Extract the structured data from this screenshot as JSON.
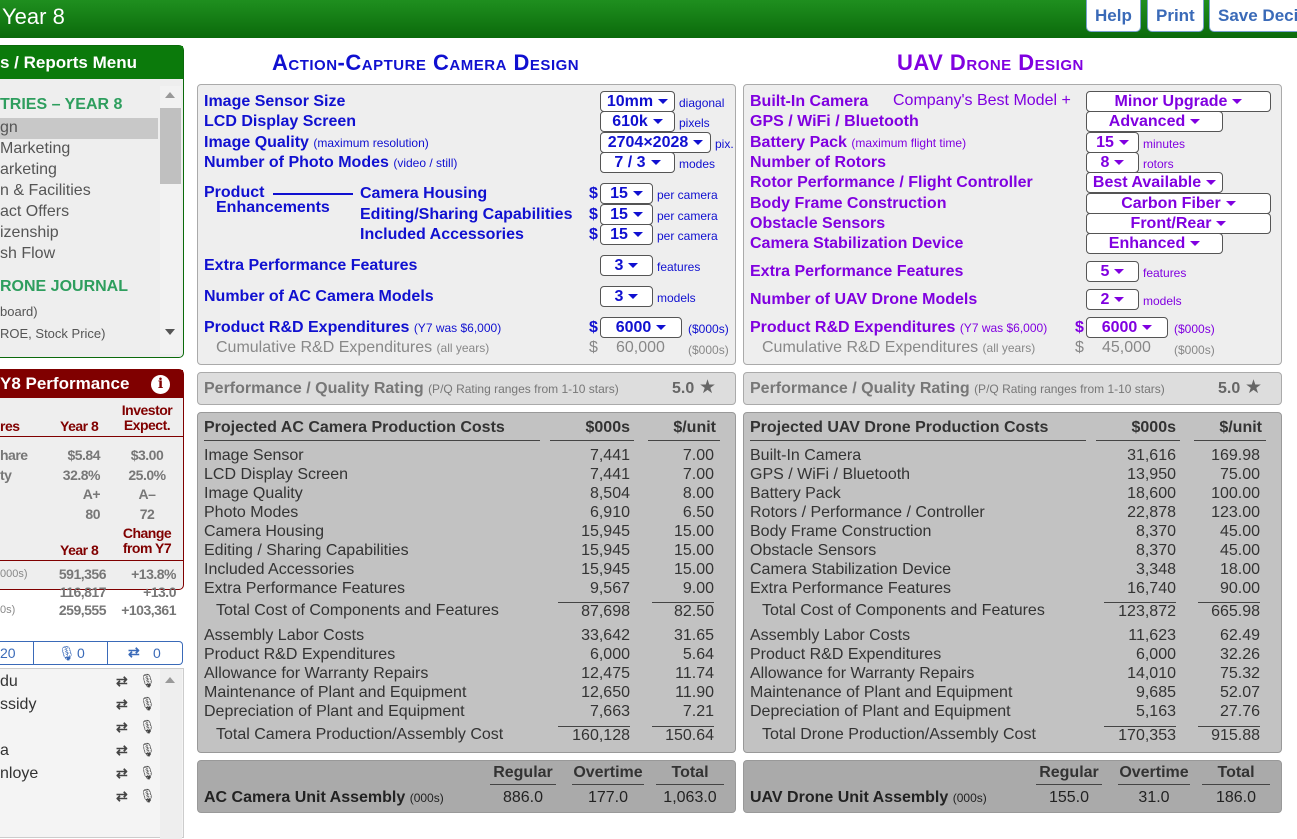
{
  "header": {
    "title": "Year 8",
    "buttons": [
      "Help",
      "Print",
      "Save Deci"
    ]
  },
  "sidebar": {
    "menu_title": "s / Reports Menu",
    "section1": "TRIES – YEAR 8",
    "items": [
      "gn",
      "Marketing",
      "arketing",
      "n & Facilities",
      "act Offers",
      "izenship",
      "sh Flow"
    ],
    "section2": "RONE JOURNAL",
    "journal_items": [
      "board)",
      "ROE, Stock Price)"
    ],
    "perf": {
      "title": "Y8 Performance",
      "col_label": "res",
      "col1": "Year 8",
      "col2": "Investor Expect.",
      "rows": [
        [
          "hare",
          "$5.84",
          "$3.00"
        ],
        [
          "ty",
          "32.8%",
          "25.0%"
        ],
        [
          "",
          "A+",
          "A–"
        ],
        [
          "",
          "80",
          "72"
        ]
      ],
      "col1b": "Year 8",
      "col2b": "Change from Y7",
      "rows2": [
        [
          "000s)",
          "591,356",
          "+13.8%"
        ],
        [
          "",
          "116,817",
          "+13.0"
        ],
        [
          "0s)",
          "259,555",
          "+103,361"
        ]
      ]
    },
    "social": {
      "count": "20",
      "mic_count": "0",
      "retweet_count": "0"
    },
    "people": [
      "du",
      "ssidy",
      "",
      "a",
      "nloye",
      ""
    ]
  },
  "camera": {
    "title": "Action-Capture Camera Design",
    "rows": [
      {
        "label": "Image Sensor Size",
        "note": "",
        "value": "10mm",
        "unit": "diagonal"
      },
      {
        "label": "LCD Display Screen",
        "note": "",
        "value": "610k",
        "unit": "pixels"
      },
      {
        "label": "Image Quality",
        "note": "(maximum resolution)",
        "value": "2704×2028",
        "unit": "pix."
      },
      {
        "label": "Number of Photo Modes",
        "note": "(video / still)",
        "value": "7 / 3",
        "unit": "modes"
      }
    ],
    "enh_label1": "Product",
    "enh_label2": "Enhancements",
    "enh": [
      {
        "label": "Camera Housing",
        "value": "15",
        "unit": "per camera"
      },
      {
        "label": "Editing/Sharing Capabilities",
        "value": "15",
        "unit": "per camera"
      },
      {
        "label": "Included Accessories",
        "value": "15",
        "unit": "per camera"
      }
    ],
    "extra": {
      "label": "Extra Performance Features",
      "value": "3",
      "unit": "features"
    },
    "models": {
      "label": "Number of AC Camera Models",
      "value": "3",
      "unit": "models"
    },
    "rd": {
      "label": "Product R&D Expenditures",
      "note": "(Y7 was $6,000)",
      "value": "6000",
      "unit": "($000s)"
    },
    "cum": {
      "label": "Cumulative R&D Expenditures",
      "note": "(all years)",
      "value": "60,000",
      "unit": "($000s)"
    },
    "rating": {
      "label": "Performance / Quality Rating",
      "note": "(P/Q Rating ranges from 1-10 stars)",
      "value": "5.0"
    },
    "costs": {
      "title": "Projected AC Camera Production Costs",
      "col1": "$000s",
      "col2": "$/unit",
      "rows": [
        [
          "Image Sensor",
          "7,441",
          "7.00"
        ],
        [
          "LCD Display Screen",
          "7,441",
          "7.00"
        ],
        [
          "Image Quality",
          "8,504",
          "8.00"
        ],
        [
          "Photo Modes",
          "6,910",
          "6.50"
        ],
        [
          "Camera Housing",
          "15,945",
          "15.00"
        ],
        [
          "Editing / Sharing Capabilities",
          "15,945",
          "15.00"
        ],
        [
          "Included Accessories",
          "15,945",
          "15.00"
        ],
        [
          "Extra Performance Features",
          "9,567",
          "9.00"
        ]
      ],
      "subtotal": [
        "Total Cost of Components and Features",
        "87,698",
        "82.50"
      ],
      "rows2": [
        [
          "Assembly Labor Costs",
          "33,642",
          "31.65"
        ],
        [
          "Product R&D Expenditures",
          "6,000",
          "5.64"
        ],
        [
          "Allowance for Warranty Repairs",
          "12,475",
          "11.74"
        ],
        [
          "Maintenance of Plant and Equipment",
          "12,650",
          "11.90"
        ],
        [
          "Depreciation of Plant and Equipment",
          "7,663",
          "7.21"
        ]
      ],
      "total": [
        "Total Camera Production/Assembly Cost",
        "160,128",
        "150.64"
      ]
    },
    "assembly": {
      "label": "AC Camera Unit Assembly",
      "note": "(000s)",
      "cols": [
        "Regular",
        "Overtime",
        "Total"
      ],
      "values": [
        "886.0",
        "177.0",
        "1,063.0"
      ]
    }
  },
  "drone": {
    "title": "UAV Drone Design",
    "camera_note": "Company's Best Model +",
    "rows": [
      {
        "label": "Built-In Camera",
        "note": "",
        "value": "Minor Upgrade",
        "unit": ""
      },
      {
        "label": "GPS / WiFi / Bluetooth",
        "note": "",
        "value": "Advanced",
        "unit": ""
      },
      {
        "label": "Battery Pack",
        "note": "(maximum flight time)",
        "value": "15",
        "unit": "minutes"
      },
      {
        "label": "Number of Rotors",
        "note": "",
        "value": "8",
        "unit": "rotors"
      },
      {
        "label": "Rotor Performance / Flight Controller",
        "note": "",
        "value": "Best Available",
        "unit": ""
      },
      {
        "label": "Body Frame Construction",
        "note": "",
        "value": "Carbon Fiber",
        "unit": ""
      },
      {
        "label": "Obstacle Sensors",
        "note": "",
        "value": "Front/Rear",
        "unit": ""
      },
      {
        "label": "Camera Stabilization Device",
        "note": "",
        "value": "Enhanced",
        "unit": ""
      }
    ],
    "extra": {
      "label": "Extra Performance Features",
      "value": "5",
      "unit": "features"
    },
    "models": {
      "label": "Number of UAV Drone Models",
      "value": "2",
      "unit": "models"
    },
    "rd": {
      "label": "Product R&D Expenditures",
      "note": "(Y7 was $6,000)",
      "value": "6000",
      "unit": "($000s)"
    },
    "cum": {
      "label": "Cumulative R&D Expenditures",
      "note": "(all years)",
      "value": "45,000",
      "unit": "($000s)"
    },
    "rating": {
      "label": "Performance / Quality Rating",
      "note": "(P/Q Rating ranges from 1-10 stars)",
      "value": "5.0"
    },
    "costs": {
      "title": "Projected UAV Drone Production Costs",
      "col1": "$000s",
      "col2": "$/unit",
      "rows": [
        [
          "Built-In Camera",
          "31,616",
          "169.98"
        ],
        [
          "GPS / WiFi / Bluetooth",
          "13,950",
          "75.00"
        ],
        [
          "Battery Pack",
          "18,600",
          "100.00"
        ],
        [
          "Rotors / Performance / Controller",
          "22,878",
          "123.00"
        ],
        [
          "Body Frame Construction",
          "8,370",
          "45.00"
        ],
        [
          "Obstacle Sensors",
          "8,370",
          "45.00"
        ],
        [
          "Camera Stabilization Device",
          "3,348",
          "18.00"
        ],
        [
          "Extra Performance Features",
          "16,740",
          "90.00"
        ]
      ],
      "subtotal": [
        "Total Cost of Components and Features",
        "123,872",
        "665.98"
      ],
      "rows2": [
        [
          "Assembly Labor Costs",
          "11,623",
          "62.49"
        ],
        [
          "Product R&D Expenditures",
          "6,000",
          "32.26"
        ],
        [
          "Allowance for Warranty Repairs",
          "14,010",
          "75.32"
        ],
        [
          "Maintenance of Plant and Equipment",
          "9,685",
          "52.07"
        ],
        [
          "Depreciation of Plant and Equipment",
          "5,163",
          "27.76"
        ]
      ],
      "total": [
        "Total Drone Production/Assembly Cost",
        "170,353",
        "915.88"
      ]
    },
    "assembly": {
      "label": "UAV Drone Unit Assembly",
      "note": "(000s)",
      "cols": [
        "Regular",
        "Overtime",
        "Total"
      ],
      "values": [
        "155.0",
        "31.0",
        "186.0"
      ]
    }
  },
  "colors": {
    "header_green": "#0b6a0b",
    "camera_blue": "#1010d0",
    "drone_purple": "#8000e0",
    "perf_red": "#800000",
    "journal_green": "#2e9e5e"
  },
  "icons": {
    "dropdown": "caret-down",
    "star": "star",
    "info": "info-circle",
    "mic": "microphone",
    "retweet": "retweet"
  }
}
